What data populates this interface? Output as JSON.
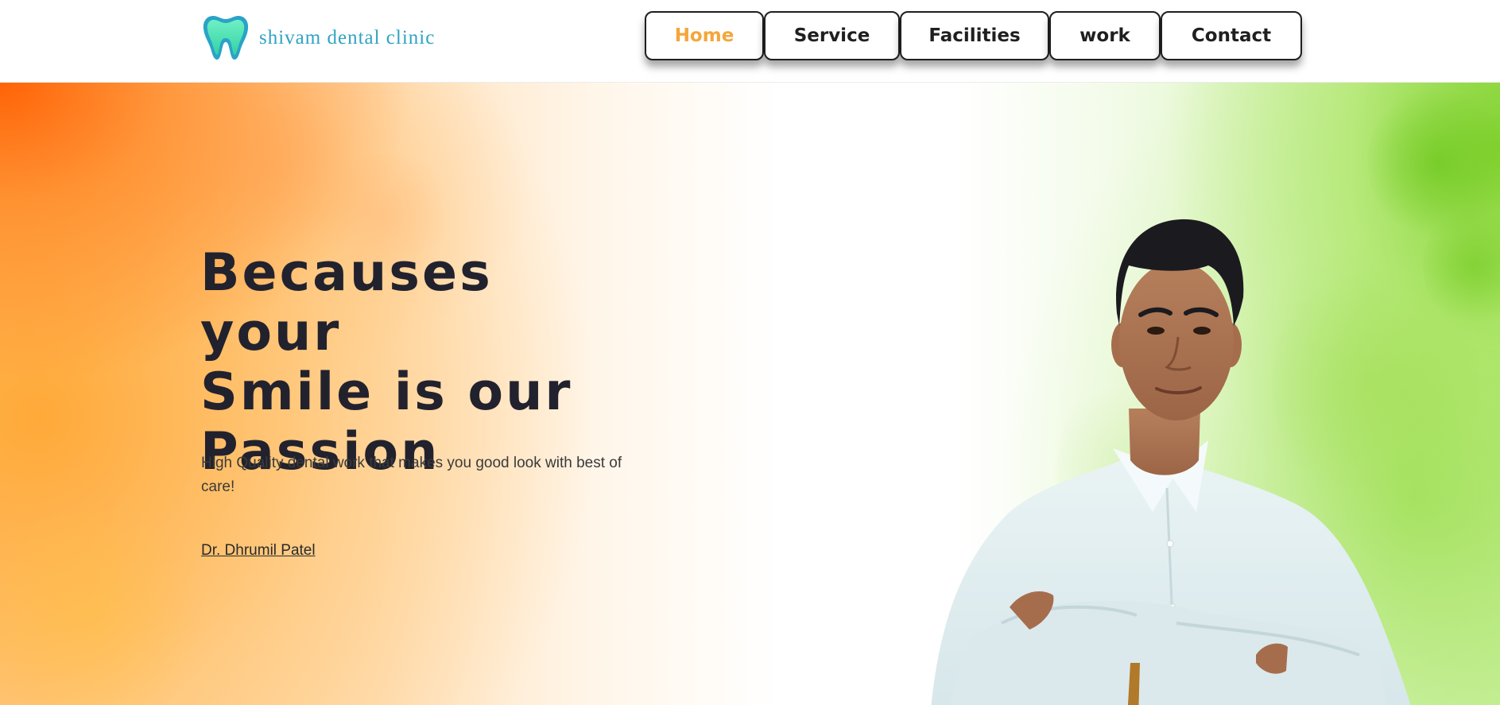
{
  "header": {
    "logo_text": "shivam dental clinic",
    "nav": [
      {
        "label": "Home",
        "active": true
      },
      {
        "label": "Service",
        "active": false
      },
      {
        "label": "Facilities",
        "active": false
      },
      {
        "label": "work",
        "active": false
      },
      {
        "label": "Contact",
        "active": false
      }
    ]
  },
  "hero": {
    "headline_line1": "Becauses your",
    "headline_line2": "Smile is our",
    "headline_line3": "Passion",
    "subtext": "High Quality dental work that makes you good look with best of care!",
    "doctor_link": "Dr. Dhrumil Patel"
  },
  "colors": {
    "accent_active_nav": "#f4a63a",
    "logo_text": "#2fa3c4",
    "headline": "#22222e",
    "hero_left": "#ff8a1a",
    "hero_right": "#7ed02a"
  },
  "icons": {
    "logo": "tooth-icon"
  }
}
